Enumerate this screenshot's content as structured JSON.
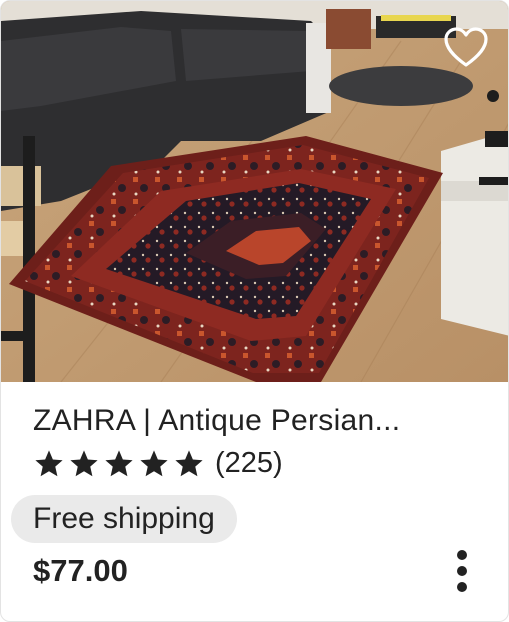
{
  "listing": {
    "title": "ZAHRA | Antique Persian...",
    "rating": 5,
    "rating_max": 5,
    "review_count": "(225)",
    "shipping_badge": "Free shipping",
    "price": "$77.00",
    "favorite_icon": "heart-outline-icon",
    "more_icon": "vertical-ellipsis-icon"
  },
  "colors": {
    "text": "#222222",
    "badge_bg": "#eaeaea",
    "rug_red": "#8e2a22",
    "rug_dark": "#2a1f2b"
  }
}
